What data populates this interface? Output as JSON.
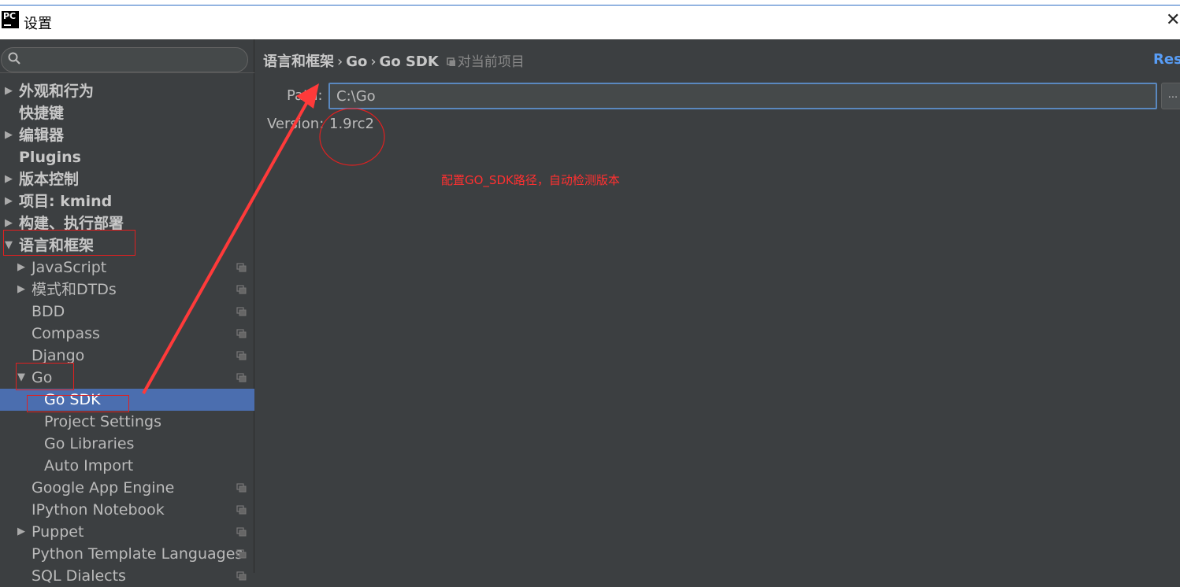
{
  "window": {
    "title": "设置",
    "logo_text": "PC"
  },
  "search": {
    "placeholder": ""
  },
  "sidebar": {
    "items": [
      {
        "label": "外观和行为",
        "arrow": "▶",
        "level": 0,
        "bold": true
      },
      {
        "label": "快捷键",
        "arrow": "",
        "level": 0,
        "bold": true
      },
      {
        "label": "编辑器",
        "arrow": "▶",
        "level": 0,
        "bold": true
      },
      {
        "label": "Plugins",
        "arrow": "",
        "level": 0,
        "bold": true
      },
      {
        "label": "版本控制",
        "arrow": "▶",
        "level": 0,
        "bold": true
      },
      {
        "label": "项目: kmind",
        "arrow": "▶",
        "level": 0,
        "bold": true
      },
      {
        "label": "构建、执行部署",
        "arrow": "▶",
        "level": 0,
        "bold": true
      },
      {
        "label": "语言和框架",
        "arrow": "▼",
        "level": 0,
        "bold": true
      },
      {
        "label": "JavaScript",
        "arrow": "▶",
        "level": 1,
        "bold": false,
        "project_icon": true
      },
      {
        "label": "模式和DTDs",
        "arrow": "▶",
        "level": 1,
        "bold": false,
        "project_icon": true
      },
      {
        "label": "BDD",
        "arrow": "",
        "level": 1,
        "bold": false,
        "project_icon": true
      },
      {
        "label": "Compass",
        "arrow": "",
        "level": 1,
        "bold": false,
        "project_icon": true
      },
      {
        "label": "Django",
        "arrow": "",
        "level": 1,
        "bold": false,
        "project_icon": true
      },
      {
        "label": "Go",
        "arrow": "▼",
        "level": 1,
        "bold": false,
        "project_icon": true
      },
      {
        "label": "Go SDK",
        "arrow": "",
        "level": 2,
        "bold": false,
        "selected": true
      },
      {
        "label": "Project Settings",
        "arrow": "",
        "level": 2,
        "bold": false
      },
      {
        "label": "Go Libraries",
        "arrow": "",
        "level": 2,
        "bold": false
      },
      {
        "label": "Auto Import",
        "arrow": "",
        "level": 2,
        "bold": false
      },
      {
        "label": "Google App Engine",
        "arrow": "",
        "level": 1,
        "bold": false,
        "project_icon": true
      },
      {
        "label": "IPython Notebook",
        "arrow": "",
        "level": 1,
        "bold": false,
        "project_icon": true
      },
      {
        "label": "Puppet",
        "arrow": "▶",
        "level": 1,
        "bold": false,
        "project_icon": true
      },
      {
        "label": "Python Template Languages",
        "arrow": "",
        "level": 1,
        "bold": false,
        "project_icon": true
      },
      {
        "label": "SQL Dialects",
        "arrow": "",
        "level": 1,
        "bold": false,
        "project_icon": true
      }
    ]
  },
  "breadcrumb": {
    "part1": "语言和框架",
    "part2": "Go",
    "part3": "Go SDK",
    "separator": "›",
    "scope_label": "对当前项目"
  },
  "reset_label": "Reset",
  "form": {
    "path_label": "Path:",
    "path_value": "C:\\Go",
    "browse_label": "...",
    "version_label": "Version:",
    "version_value": "1.9rc2"
  },
  "annotation": {
    "text": "配置GO_SDK路径，自动检测版本"
  },
  "colors": {
    "selected": "#4b6eaf",
    "annotation": "#ff3030",
    "link": "#589df6"
  }
}
